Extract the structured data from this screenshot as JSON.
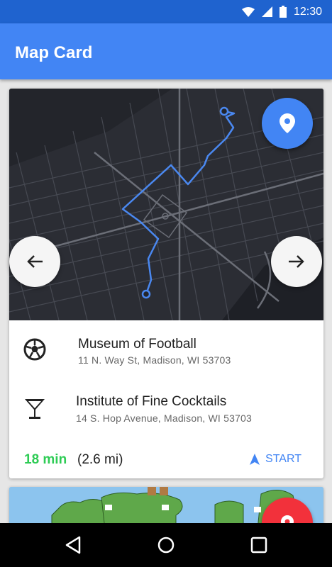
{
  "status_bar": {
    "time": "12:30",
    "icons": [
      "wifi-icon",
      "signal-icon",
      "battery-icon"
    ]
  },
  "app_bar": {
    "title": "Map Card"
  },
  "colors": {
    "primary": "#4285f4",
    "primary_dark": "#1f63cf",
    "accent_green": "#2ecc55",
    "accent_red": "#f2313b",
    "map_bg": "#23252b",
    "route": "#4a88f0"
  },
  "card": {
    "places": [
      {
        "icon": "soccer-ball-icon",
        "name": "Museum of Football",
        "address": "11 N. Way St, Madison, WI 53703"
      },
      {
        "icon": "cocktail-icon",
        "name": "Institute of Fine Cocktails",
        "address": "14 S. Hop Avenue, Madison, WI 53703"
      }
    ],
    "duration": "18 min",
    "distance": "(2.6 mi)",
    "start_label": "START"
  },
  "nav_bar": {
    "items": [
      "back-icon",
      "home-icon",
      "recents-icon"
    ]
  }
}
